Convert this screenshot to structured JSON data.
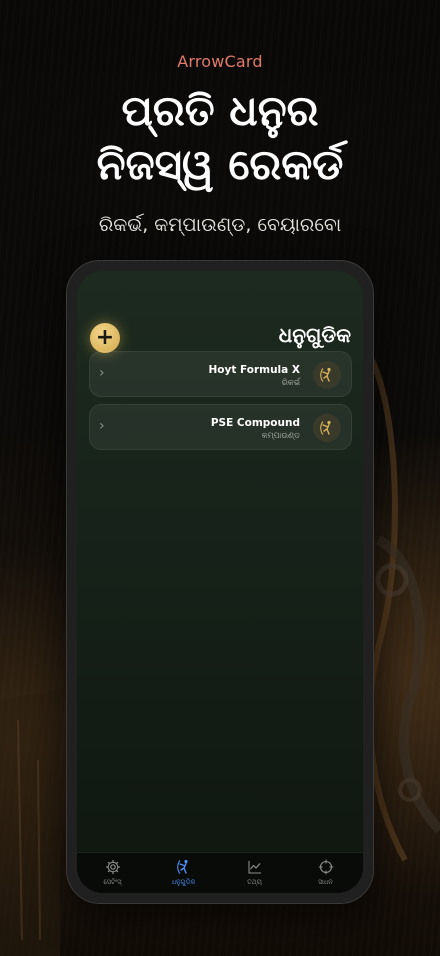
{
  "promo": {
    "brand": "ArrowCard",
    "headline_line1": "ପ୍ରତି ଧନୁର",
    "headline_line2": "ନିଜସ୍ୱ ରେକର୍ଡ",
    "subheadline": "ରିକର୍ଭ, କମ୍ପାଉଣ୍ଡ, ବେୟାରବୋ"
  },
  "screen": {
    "title": "ଧନୁଗୁଡିକ",
    "add_label": "+"
  },
  "bows": [
    {
      "name": "Hoyt Formula X",
      "type": "ରିକର୍ଭ",
      "icon": "archer-icon"
    },
    {
      "name": "PSE Compound",
      "type": "କମ୍ପାଉଣ୍ଡ",
      "icon": "archer-icon"
    }
  ],
  "tabs": [
    {
      "label": "ସେଟିଂସ୍",
      "icon": "gear-icon",
      "active": false
    },
    {
      "label": "ଧନୁଗୁଡିକ",
      "icon": "archer-icon",
      "active": true
    },
    {
      "label": "ତଥ୍ୟ",
      "icon": "chart-icon",
      "active": false
    },
    {
      "label": "ସାଧନ",
      "icon": "crosshair-icon",
      "active": false
    }
  ],
  "colors": {
    "brand": "#e07b6a",
    "accent_gold": "#d9b35a",
    "tab_active": "#4f8ff7"
  }
}
